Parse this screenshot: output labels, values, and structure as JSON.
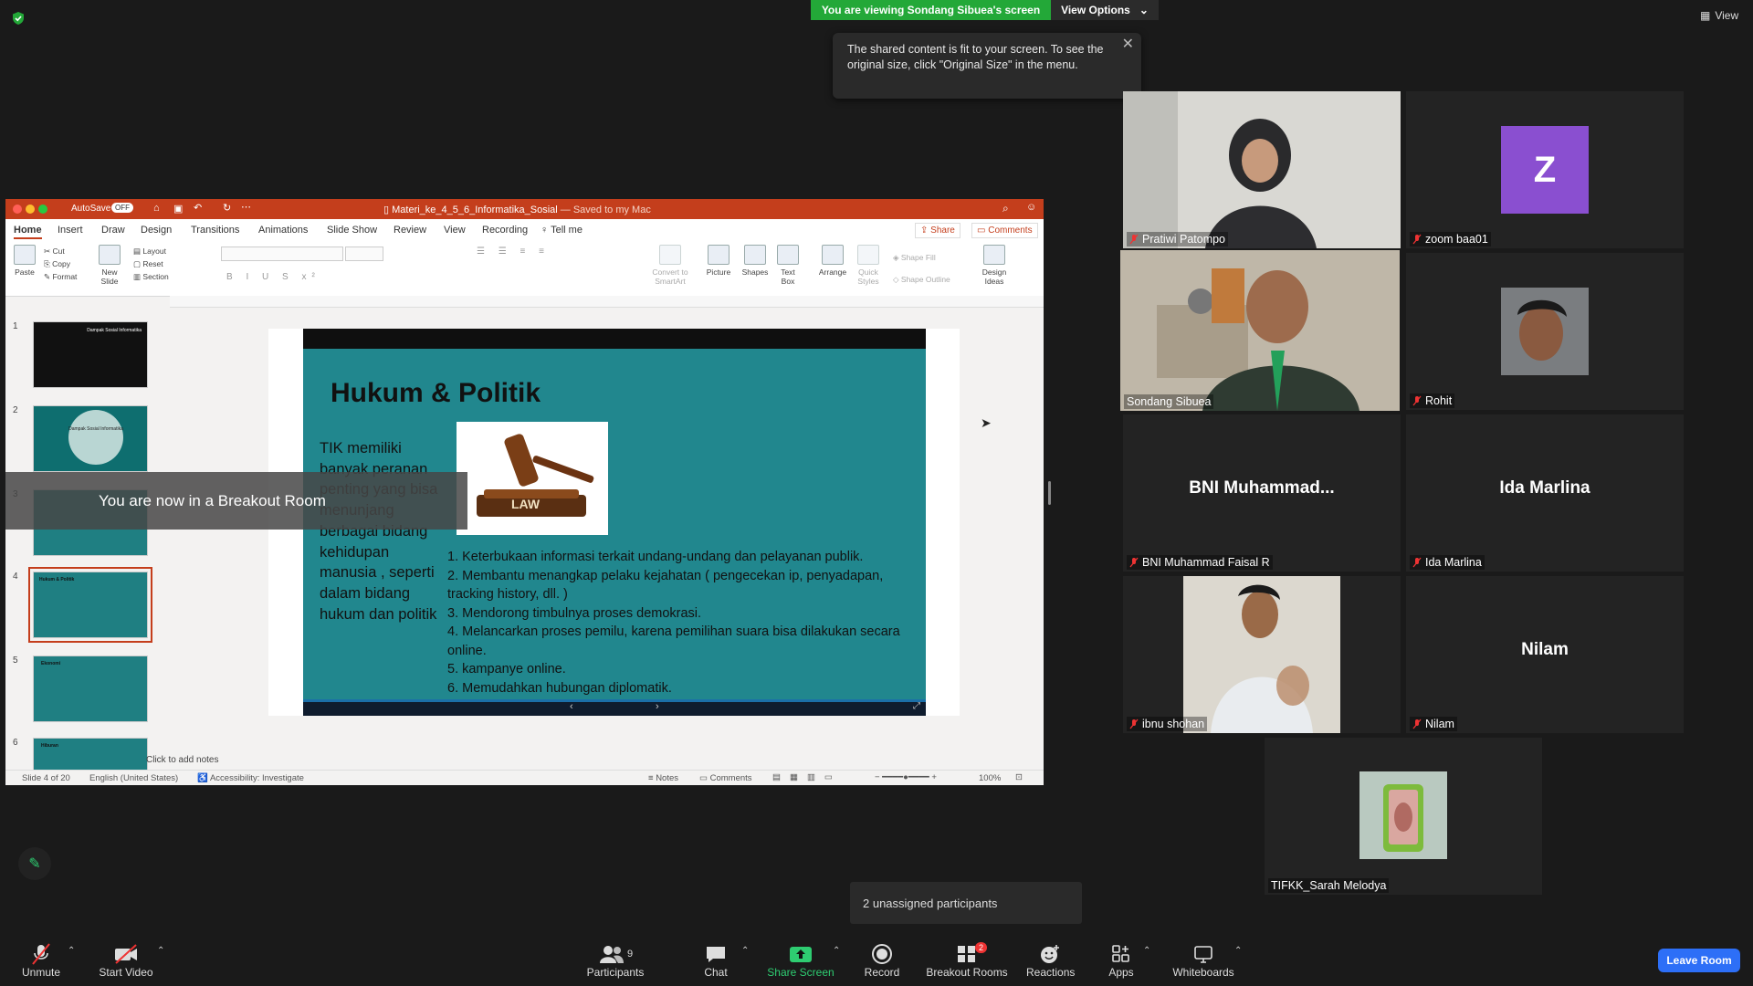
{
  "banner": {
    "viewing": "You are viewing Sondang Sibuea's screen",
    "view_options": "View Options",
    "view": "View"
  },
  "tooltip": {
    "text": "The shared content is fit to your screen. To see the original size, click \"Original Size\" in the menu."
  },
  "ppt": {
    "autosave": "AutoSave",
    "autosave_state": "OFF",
    "title": "Materi_ke_4_5_6_Informatika_Sosial",
    "saved": "— Saved to my Mac",
    "tabs": [
      "Home",
      "Insert",
      "Draw",
      "Design",
      "Transitions",
      "Animations",
      "Slide Show",
      "Review",
      "View",
      "Recording",
      "Tell me"
    ],
    "share": "Share",
    "comments": "Comments",
    "ribbon": {
      "paste": "Paste",
      "cut": "Cut",
      "copy": "Copy",
      "format": "Format",
      "new_slide": "New Slide",
      "layout": "Layout",
      "reset": "Reset",
      "section": "Section",
      "convert": "Convert to SmartArt",
      "picture": "Picture",
      "shapes": "Shapes",
      "textbox": "Text Box",
      "arrange": "Arrange",
      "quick_styles": "Quick Styles",
      "shape_fill": "Shape Fill",
      "shape_outline": "Shape Outline",
      "design_ideas": "Design Ideas"
    },
    "thumb_numbers": [
      "1",
      "2",
      "3",
      "4",
      "5",
      "6"
    ],
    "thumb_texts": {
      "t1": "Dampak Sosial Informatika",
      "t2": "Dampak Sosial Informatika",
      "t4": "Hukum & Politik",
      "t5": "Ekonomi",
      "t6": "Hiburan"
    },
    "notes": "Click to add notes",
    "status": {
      "slide": "Slide 4 of 20",
      "lang": "English (United States)",
      "access": "Accessibility: Investigate",
      "notes": "Notes",
      "comments": "Comments",
      "zoom": "100%"
    }
  },
  "slide": {
    "title": "Hukum & Politik",
    "left_text": "TIK memiliki banyak peranan penting yang bisa menunjang berbagai bidang kehidupan manusia , seperti dalam bidang hukum dan politik",
    "gavel_label": "LAW",
    "list": [
      "1. Keterbukaan informasi terkait undang-undang dan pelayanan publik.",
      "2. Membantu menangkap pelaku kejahatan ( pengecekan ip, penyadapan, tracking history, dll. )",
      "3. Mendorong timbulnya proses demokrasi.",
      "4. Melancarkan proses pemilu, karena pemilihan suara bisa dilakukan secara online.",
      "5. kampanye online.",
      "6. Memudahkan hubungan diplomatik."
    ]
  },
  "breakout_message": "You are now in a Breakout Room",
  "participants": [
    {
      "name": "Pratiwi Patompo"
    },
    {
      "name": "zoom baa01",
      "avatar_letter": "Z"
    },
    {
      "name": "Sondang Sibuea"
    },
    {
      "name": "Rohit"
    },
    {
      "name": "BNI Muhammad Faisal R",
      "display": "BNI  Muhammad..."
    },
    {
      "name": "Ida Marlina",
      "display": "Ida Marlina"
    },
    {
      "name": "ibnu shohan"
    },
    {
      "name": "Nilam",
      "display": "Nilam"
    },
    {
      "name": "TIFKK_Sarah Melodya"
    }
  ],
  "unassigned": "2 unassigned participants",
  "toolbar": {
    "unmute": "Unmute",
    "start_video": "Start Video",
    "participants": "Participants",
    "participants_count": "9",
    "chat": "Chat",
    "share_screen": "Share Screen",
    "record": "Record",
    "breakout_rooms": "Breakout Rooms",
    "breakout_badge": "2",
    "reactions": "Reactions",
    "apps": "Apps",
    "whiteboards": "Whiteboards",
    "leave": "Leave Room"
  },
  "colors": {
    "green": "#23a838",
    "ppt_red": "#c43e1c",
    "slide_teal": "#21878e",
    "leave_blue": "#2d6ff7",
    "active_border": "#c6e03a",
    "avatar_purple": "#8a4fd0"
  }
}
